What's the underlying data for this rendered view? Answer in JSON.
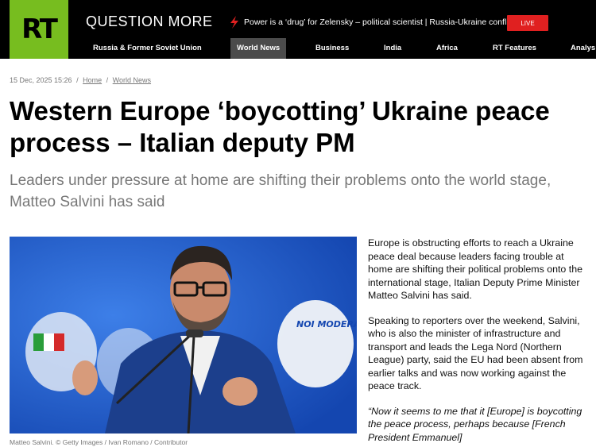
{
  "header": {
    "logo_text": "RT",
    "slogan": "QUESTION MORE",
    "ticker_text": "Power is a ‘drug’ for Zelensky – political scientist | Russia-Ukraine conflict",
    "live_label": "LIVE",
    "brand_color": "#77bd1f",
    "live_color": "#e02020"
  },
  "nav": {
    "items": [
      {
        "label": "Russia & Former Soviet Union"
      },
      {
        "label": "World News",
        "active": true
      },
      {
        "label": "Business"
      },
      {
        "label": "India"
      },
      {
        "label": "Africa"
      },
      {
        "label": "RT Features"
      },
      {
        "label": "Analys"
      }
    ]
  },
  "article": {
    "date": "15 Dec, 2025 15:26",
    "breadcrumb": [
      "Home",
      "World News"
    ],
    "title": "Western Europe ‘boycotting’ Ukraine peace process – Italian deputy PM",
    "summary": "Leaders under pressure at home are shifting their problems onto the world stage, Matteo Salvini has said",
    "photo_caption": "Matteo Salvini. © Getty Images / Ivan Romano / Contributor",
    "photo_sign_text": "NOI MODERATI",
    "paragraphs": [
      "Europe is obstructing efforts to reach a Ukraine peace deal because leaders facing trouble at home are shifting their political problems onto the international stage, Italian Deputy Prime Minister Matteo Salvini has said.",
      "Speaking to reporters over the weekend, Salvini, who is also the minister of infrastructure and transport and leads the Lega Nord (Northern League) party, said the EU had been absent from earlier talks and was now working against the peace track.",
      "“Now it seems to me that it [Europe] is boycotting the peace process, perhaps because [French President Emmanuel]"
    ]
  }
}
